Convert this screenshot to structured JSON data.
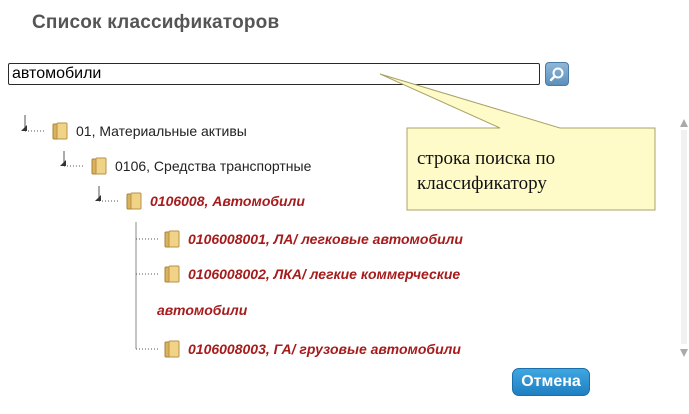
{
  "dialog": {
    "title": "Список классификаторов"
  },
  "search": {
    "value": "автомобили",
    "button_icon": "search-icon"
  },
  "tree": {
    "level1": {
      "label": "01, Материальные активы"
    },
    "level2": {
      "label": "0106, Средства транспортные"
    },
    "level3": {
      "label": "0106008, Автомобили"
    },
    "leaves": [
      {
        "label": "0106008001, ЛА/ легковые автомобили"
      },
      {
        "label": "0106008002, ЛКА/ легкие коммерческие",
        "label_cont": "автомобили"
      },
      {
        "label": "0106008003, ГА/ грузовые автомобили"
      }
    ]
  },
  "callout": {
    "line1": "строка поиска по",
    "line2": "классификатору"
  },
  "footer": {
    "cancel_label": "Отмена"
  },
  "colors": {
    "highlight": "#a61c1c",
    "callout_bg": "#fefbc8",
    "button": "#2a8fd0"
  }
}
